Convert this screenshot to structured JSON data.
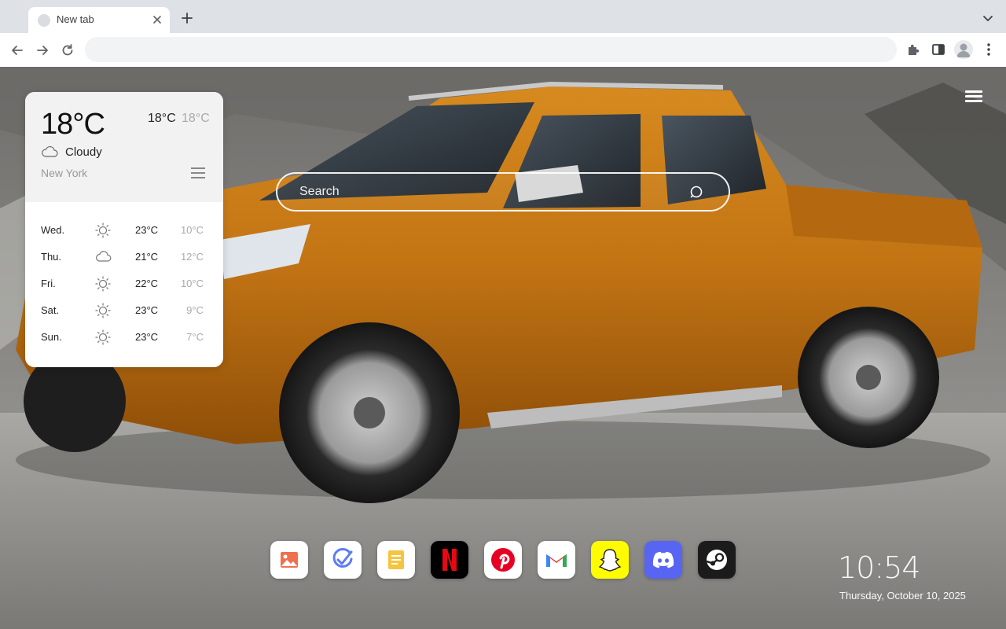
{
  "browser": {
    "tab_title": "New tab",
    "omnibox_value": "",
    "omnibox_placeholder": ""
  },
  "weather": {
    "current_temp": "18°C",
    "high": "18°C",
    "low": "18°C",
    "condition": "Cloudy",
    "condition_icon": "cloud-icon",
    "city": "New York",
    "forecast": [
      {
        "day": "Wed.",
        "icon": "sun-icon",
        "high": "23°C",
        "low": "10°C"
      },
      {
        "day": "Thu.",
        "icon": "cloud-icon",
        "high": "21°C",
        "low": "12°C"
      },
      {
        "day": "Fri.",
        "icon": "sun-icon",
        "high": "22°C",
        "low": "10°C"
      },
      {
        "day": "Sat.",
        "icon": "sun-icon",
        "high": "23°C",
        "low": "9°C"
      },
      {
        "day": "Sun.",
        "icon": "sun-icon",
        "high": "23°C",
        "low": "7°C"
      }
    ]
  },
  "search": {
    "placeholder": "Search"
  },
  "dock": [
    {
      "name": "wallpapers-app",
      "icon": "image-icon",
      "color": "#f0704e"
    },
    {
      "name": "todo-app",
      "icon": "checkmark-icon",
      "color": "#5b7cf5"
    },
    {
      "name": "notes-app",
      "icon": "note-icon",
      "color": "#f5c542"
    },
    {
      "name": "netflix-app",
      "icon": "netflix-icon",
      "color": "#e50914"
    },
    {
      "name": "pinterest-app",
      "icon": "pinterest-icon",
      "color": "#e60023"
    },
    {
      "name": "gmail-app",
      "icon": "gmail-icon",
      "color": "#ea4335"
    },
    {
      "name": "snapchat-app",
      "icon": "snapchat-icon",
      "color": "#fffc00"
    },
    {
      "name": "discord-app",
      "icon": "discord-icon",
      "color": "#5865f2"
    },
    {
      "name": "steam-app",
      "icon": "steam-icon",
      "color": "#1b1b1b"
    }
  ],
  "clock": {
    "time": "10:54",
    "date": "Thursday, October 10, 2025"
  }
}
